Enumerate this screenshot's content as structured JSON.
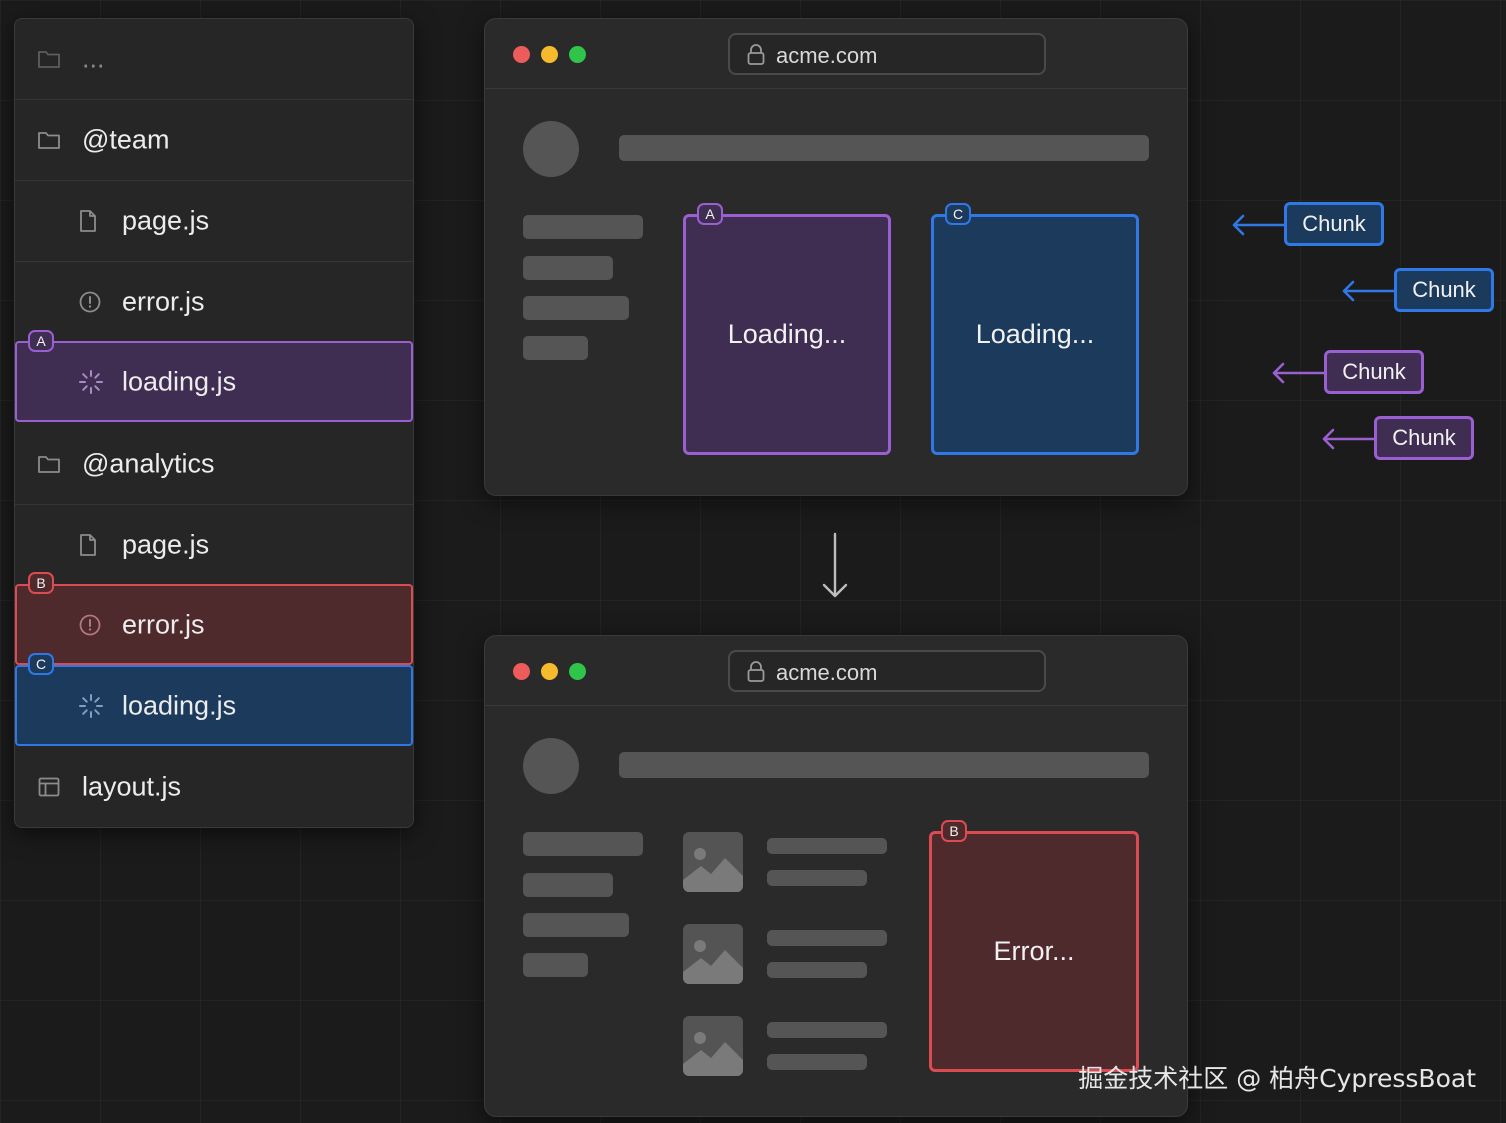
{
  "tree": {
    "rows": [
      {
        "label": "...",
        "icon": "folder-icon"
      },
      {
        "label": "@team",
        "icon": "folder-icon"
      },
      {
        "label": "page.js",
        "icon": "file-icon"
      },
      {
        "label": "error.js",
        "icon": "alert-circle-icon"
      },
      {
        "label": "loading.js",
        "icon": "spinner-icon",
        "tag": "A"
      },
      {
        "label": "@analytics",
        "icon": "folder-icon"
      },
      {
        "label": "page.js",
        "icon": "file-icon"
      },
      {
        "label": "error.js",
        "icon": "alert-circle-icon",
        "tag": "B"
      },
      {
        "label": "loading.js",
        "icon": "spinner-icon",
        "tag": "C"
      },
      {
        "label": "layout.js",
        "icon": "layout-icon"
      }
    ]
  },
  "browser_top": {
    "url": "acme.com",
    "slot_a": {
      "tag": "A",
      "text": "Loading..."
    },
    "slot_c": {
      "tag": "C",
      "text": "Loading..."
    }
  },
  "browser_bottom": {
    "url": "acme.com",
    "slot_b": {
      "tag": "B",
      "text": "Error..."
    }
  },
  "chunks": [
    "Chunk",
    "Chunk",
    "Chunk",
    "Chunk"
  ],
  "watermark": "掘金技术社区 @ 柏舟CypressBoat",
  "colors": {
    "purple": "#9a5fd0",
    "red": "#db4b52",
    "blue": "#2f78e6",
    "background": "#1b1b1b"
  }
}
